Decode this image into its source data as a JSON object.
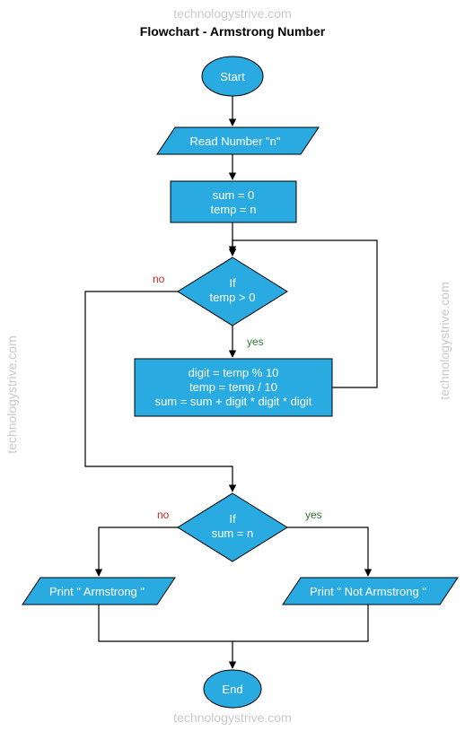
{
  "title": "Flowchart - Armstrong Number",
  "watermark": "technologystrive.com",
  "nodes": {
    "start": "Start",
    "read": "Read Number \"n\"",
    "init_l1": "sum = 0",
    "init_l2": "temp = n",
    "dec1_l1": "If",
    "dec1_l2": "temp > 0",
    "proc_l1": "digit = temp % 10",
    "proc_l2": "temp = temp / 10",
    "proc_l3": "sum = sum + digit * digit * digit",
    "dec2_l1": "If",
    "dec2_l2": "sum = n",
    "out_yes": "Print \" Armstrong \"",
    "out_no": "Print \" Not Armstrong \"",
    "end": "End"
  },
  "labels": {
    "yes": "yes",
    "no": "no"
  },
  "chart_data": {
    "type": "flowchart",
    "title": "Flowchart - Armstrong Number",
    "nodes": [
      {
        "id": "start",
        "shape": "terminator",
        "text": "Start"
      },
      {
        "id": "read",
        "shape": "io",
        "text": "Read Number \"n\""
      },
      {
        "id": "init",
        "shape": "process",
        "text": "sum = 0; temp = n"
      },
      {
        "id": "dec1",
        "shape": "decision",
        "text": "If temp > 0"
      },
      {
        "id": "loop",
        "shape": "process",
        "text": "digit = temp % 10; temp = temp / 10; sum = sum + digit * digit * digit"
      },
      {
        "id": "dec2",
        "shape": "decision",
        "text": "If sum = n"
      },
      {
        "id": "outA",
        "shape": "io",
        "text": "Print \" Armstrong \""
      },
      {
        "id": "outN",
        "shape": "io",
        "text": "Print \" Not Armstrong \""
      },
      {
        "id": "end",
        "shape": "terminator",
        "text": "End"
      }
    ],
    "edges": [
      {
        "from": "start",
        "to": "read"
      },
      {
        "from": "read",
        "to": "init"
      },
      {
        "from": "init",
        "to": "dec1"
      },
      {
        "from": "dec1",
        "to": "loop",
        "label": "yes"
      },
      {
        "from": "loop",
        "to": "dec1",
        "label": ""
      },
      {
        "from": "dec1",
        "to": "dec2",
        "label": "no"
      },
      {
        "from": "dec2",
        "to": "outA",
        "label": "no"
      },
      {
        "from": "dec2",
        "to": "outN",
        "label": "yes"
      },
      {
        "from": "outA",
        "to": "end"
      },
      {
        "from": "outN",
        "to": "end"
      }
    ]
  }
}
